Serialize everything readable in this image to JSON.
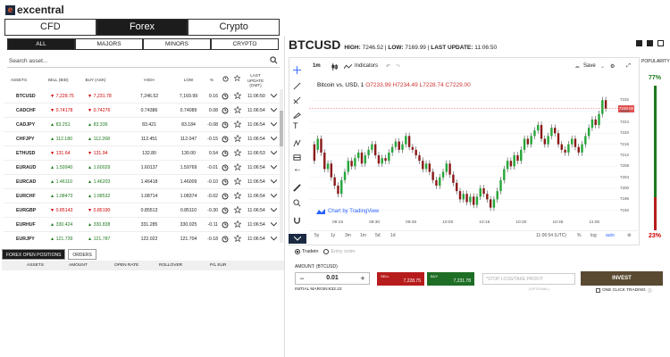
{
  "brand": {
    "name": "excentral"
  },
  "top_tabs": [
    {
      "label": "CFD"
    },
    {
      "label": "Forex"
    },
    {
      "label": "Crypto"
    }
  ],
  "sub_tabs": [
    {
      "label": "ALL"
    },
    {
      "label": "MAJORS"
    },
    {
      "label": "MINORS"
    },
    {
      "label": "CRYPTO"
    }
  ],
  "search": {
    "placeholder": "Search asset..."
  },
  "table_header": {
    "assets": "ASSETS",
    "sell": "SELL (BID)",
    "buy": "BUY (ASK)",
    "high": "HIGH",
    "low": "LOW",
    "pct": "%",
    "last": "LAST UPDATE (GMT)"
  },
  "assets": [
    {
      "symbol": "BTCUSD",
      "sell": "7,228.75",
      "buy": "7,231.78",
      "high": "7,246.52",
      "low": "7,169.99",
      "pct": "0.16",
      "time": "11:06:50",
      "dir": "dn"
    },
    {
      "symbol": "CADCHF",
      "sell": "0.74178",
      "buy": "0.74276",
      "high": "0.74386",
      "low": "0.74089",
      "pct": "0.08",
      "time": "11:06:54",
      "dir": "dn"
    },
    {
      "symbol": "CADJPY",
      "sell": "83.251",
      "buy": "83.336",
      "high": "83.421",
      "low": "83.184",
      "pct": "-0.08",
      "time": "11:06:54",
      "dir": "up"
    },
    {
      "symbol": "CHFJPY",
      "sell": "112.180",
      "buy": "112.268",
      "high": "112.451",
      "low": "112.047",
      "pct": "-0.15",
      "time": "11:06:54",
      "dir": "up"
    },
    {
      "symbol": "ETHUSD",
      "sell": "131.64",
      "buy": "131.94",
      "high": "132.80",
      "low": "130.00",
      "pct": "0.54",
      "time": "11:06:53",
      "dir": "dn"
    },
    {
      "symbol": "EURAUD",
      "sell": "1.59940",
      "buy": "1.60029",
      "high": "1.60137",
      "low": "1.59769",
      "pct": "-0.01",
      "time": "11:06:54",
      "dir": "up"
    },
    {
      "symbol": "EURCAD",
      "sell": "1.46110",
      "buy": "1.46203",
      "high": "1.46418",
      "low": "1.46009",
      "pct": "-0.10",
      "time": "11:06:54",
      "dir": "up"
    },
    {
      "symbol": "EURCHF",
      "sell": "1.08473",
      "buy": "1.08532",
      "high": "1.08714",
      "low": "1.08374",
      "pct": "-0.02",
      "time": "11:06:54",
      "dir": "up"
    },
    {
      "symbol": "EURGBP",
      "sell": "0.85143",
      "buy": "0.85190",
      "high": "0.85513",
      "low": "0.85110",
      "pct": "-0.30",
      "time": "11:06:54",
      "dir": "dn"
    },
    {
      "symbol": "EURHUF",
      "sell": "330.424",
      "buy": "330.838",
      "high": "331.285",
      "low": "330.025",
      "pct": "-0.11",
      "time": "11:06:54",
      "dir": "up"
    },
    {
      "symbol": "EURJPY",
      "sell": "121.739",
      "buy": "121.787",
      "high": "122.022",
      "low": "121.704",
      "pct": "-0.18",
      "time": "11:06:54",
      "dir": "up"
    }
  ],
  "positions": {
    "tabs": [
      {
        "label": "FOREX OPEN POSITIONS"
      },
      {
        "label": "ORDERS"
      }
    ],
    "columns": [
      "ASSETS",
      "AMOUNT",
      "OPEN RATE",
      "ROLLOVER",
      "P/L EUR"
    ]
  },
  "instrument": {
    "symbol": "BTCUSD",
    "high_label": "HIGH:",
    "high": "7246.52",
    "low_label": "LOW:",
    "low": "7169.99",
    "last_label": "LAST UPDATE:",
    "last": "11:06:50"
  },
  "chart_toolbar": {
    "interval": "1m",
    "indicators": "Indicators",
    "save": "Save"
  },
  "chart_legend": {
    "name": "Bitcoin vs. USD, 1",
    "o": "O7233.99",
    "h": "H7234.49",
    "l": "L7228.74",
    "c": "C7229.00"
  },
  "price_tag": "7229.00",
  "attribution": "Chart by TradingView",
  "bottom_toolbar": {
    "ranges": [
      "5y",
      "1y",
      "3m",
      "1m",
      "5d",
      "1d"
    ],
    "time": "11:06:54 (UTC)",
    "pct": "%",
    "log": "log",
    "auto": "auto"
  },
  "popularity": {
    "label": "POPULARITY",
    "buy_pct": "77%",
    "sell_pct": "23%",
    "buy_fraction": 0.77
  },
  "order": {
    "tradein": "Tradein",
    "entry": "Entry order",
    "amount_label": "AMOUNT: (BTCUSD)",
    "amount": "0.01",
    "margin": "INITIAL MARGIN:€32.22",
    "sell_label": "SELL",
    "sell_price": "7,228.75",
    "buy_label": "BUY",
    "buy_price": "7,231.78",
    "stop_placeholder": "*STOP LOSS/TAKE PROFIT",
    "optional": "(OPTIONAL)",
    "invest": "INVEST",
    "one_click": "ONE CLICK TRADING"
  },
  "chart_data": {
    "type": "candlestick",
    "title": "Bitcoin vs. USD, 1",
    "x_ticks": [
      "09:15",
      "09:30",
      "09:45",
      "10:00",
      "10:15",
      "10:30",
      "10:45",
      "11:00"
    ],
    "y_ticks": [
      7232,
      7228,
      7224,
      7220,
      7216,
      7212,
      7208,
      7204,
      7200,
      7196,
      7192
    ],
    "ylim": [
      7189,
      7235
    ],
    "candles": [
      [
        7216,
        7210
      ],
      [
        7214,
        7218
      ],
      [
        7218,
        7213
      ],
      [
        7213,
        7207
      ],
      [
        7207,
        7209
      ],
      [
        7209,
        7204
      ],
      [
        7204,
        7201
      ],
      [
        7201,
        7198
      ],
      [
        7198,
        7203
      ],
      [
        7203,
        7206
      ],
      [
        7206,
        7210
      ],
      [
        7210,
        7208
      ],
      [
        7208,
        7211
      ],
      [
        7211,
        7213
      ],
      [
        7213,
        7209
      ],
      [
        7209,
        7212
      ],
      [
        7212,
        7214
      ],
      [
        7214,
        7216
      ],
      [
        7216,
        7212
      ],
      [
        7212,
        7209
      ],
      [
        7209,
        7211
      ],
      [
        7211,
        7210
      ],
      [
        7210,
        7213
      ],
      [
        7213,
        7215
      ],
      [
        7215,
        7217
      ],
      [
        7217,
        7214
      ],
      [
        7214,
        7216
      ],
      [
        7216,
        7219
      ],
      [
        7219,
        7215
      ],
      [
        7215,
        7214
      ],
      [
        7214,
        7212
      ],
      [
        7212,
        7210
      ],
      [
        7210,
        7207
      ],
      [
        7207,
        7209
      ],
      [
        7209,
        7206
      ],
      [
        7206,
        7203
      ],
      [
        7203,
        7201
      ],
      [
        7201,
        7204
      ],
      [
        7204,
        7206
      ],
      [
        7206,
        7209
      ],
      [
        7209,
        7205
      ],
      [
        7205,
        7202
      ],
      [
        7202,
        7199
      ],
      [
        7199,
        7196
      ],
      [
        7196,
        7198
      ],
      [
        7198,
        7195
      ],
      [
        7195,
        7197
      ],
      [
        7197,
        7194
      ],
      [
        7194,
        7197
      ],
      [
        7197,
        7200
      ],
      [
        7200,
        7198
      ],
      [
        7198,
        7196
      ],
      [
        7196,
        7193
      ],
      [
        7193,
        7196
      ],
      [
        7196,
        7199
      ],
      [
        7199,
        7203
      ],
      [
        7203,
        7207
      ],
      [
        7207,
        7210
      ],
      [
        7210,
        7208
      ],
      [
        7208,
        7212
      ],
      [
        7212,
        7210
      ],
      [
        7210,
        7214
      ],
      [
        7214,
        7218
      ],
      [
        7218,
        7216
      ],
      [
        7216,
        7219
      ],
      [
        7219,
        7221
      ],
      [
        7221,
        7223
      ],
      [
        7223,
        7218
      ],
      [
        7218,
        7216
      ],
      [
        7216,
        7219
      ],
      [
        7219,
        7222
      ],
      [
        7222,
        7220
      ],
      [
        7220,
        7216
      ],
      [
        7216,
        7214
      ],
      [
        7214,
        7213
      ],
      [
        7213,
        7216
      ],
      [
        7216,
        7218
      ],
      [
        7218,
        7215
      ],
      [
        7215,
        7213
      ],
      [
        7213,
        7216
      ],
      [
        7216,
        7219
      ],
      [
        7219,
        7222
      ],
      [
        7222,
        7225
      ],
      [
        7225,
        7223
      ],
      [
        7223,
        7227
      ],
      [
        7227,
        7232
      ],
      [
        7232,
        7229
      ]
    ]
  }
}
